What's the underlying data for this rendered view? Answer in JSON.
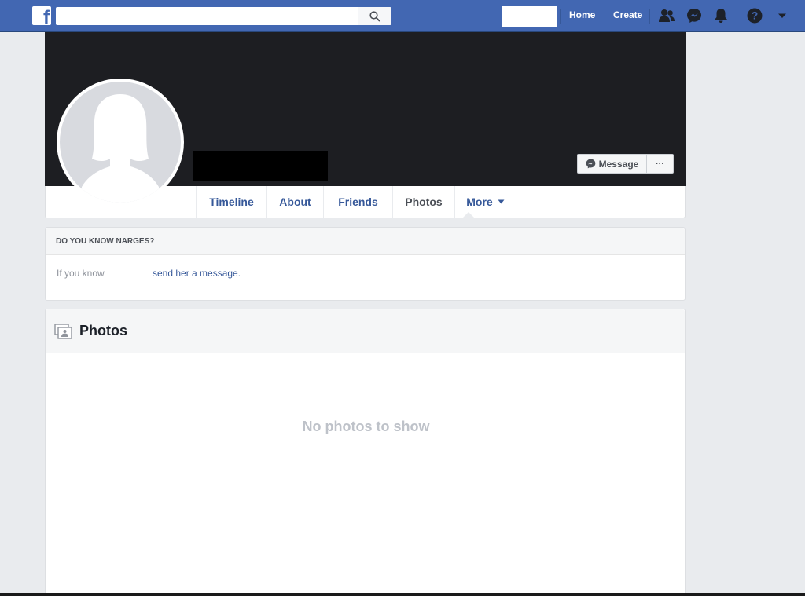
{
  "topbar": {
    "search_placeholder": "",
    "nav": {
      "home": "Home",
      "create": "Create"
    },
    "icons": [
      "facebook-logo-icon",
      "search-icon",
      "friend-requests-icon",
      "messenger-icon",
      "notifications-icon",
      "help-icon",
      "account-menu-icon"
    ]
  },
  "profile": {
    "actions": {
      "message": "Message",
      "more": "···"
    },
    "tabs": [
      {
        "label": "Timeline"
      },
      {
        "label": "About"
      },
      {
        "label": "Friends"
      },
      {
        "label": "Photos",
        "active": true
      },
      {
        "label": "More"
      }
    ]
  },
  "know_card": {
    "heading": "DO YOU KNOW NARGES?",
    "prefix": "If you know",
    "link": "send her a message."
  },
  "photos": {
    "title": "Photos",
    "empty": "No photos to show"
  },
  "colors": {
    "brand": "#4267b2",
    "cover": "#1d1e22",
    "link": "#365899",
    "page_bg": "#e9ebee"
  }
}
